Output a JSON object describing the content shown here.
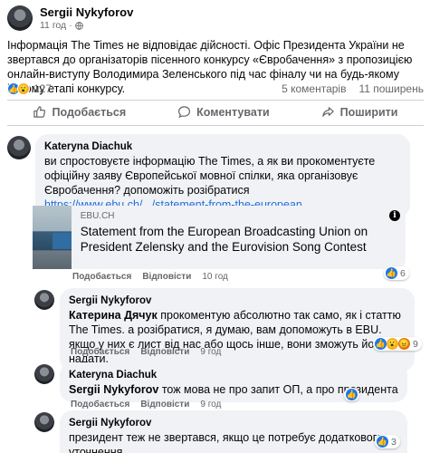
{
  "post": {
    "author": "Sergii Nykyforov",
    "time": "11 год",
    "text": "Інформація The Times не відповідає дійсності. Офіс Президента України не звертався до організаторів пісенного конкурсу «Євробачення» з пропозицією онлайн-виступу Володимира Зеленського під час фіналу чи на будь-якому іншому етапі конкурсу.",
    "reactions_count": "127",
    "comments_count": "5 коментарів",
    "shares_count": "11 поширень"
  },
  "actions": {
    "like": "Подобається",
    "comment": "Коментувати",
    "share": "Поширити"
  },
  "comments": [
    {
      "author": "Kateryna Diachuk",
      "text": "ви спростовуєте інформацію The Times, а як ви прокоментуєте офіційну заяву Європейської мовної спілки, яка організовує Євробачення? допоможіть розібратися",
      "link": "https://www.ebu.ch/.../statement-from-the-european...",
      "card_domain": "EBU.CH",
      "card_title": "Statement from the European Broadcasting Union on President Zelensky and the Eurovision Song Contest",
      "like": "Подобається",
      "reply": "Відповісти",
      "time": "10 год",
      "reactions": "6"
    },
    {
      "author": "Sergii Nykyforov",
      "tag": "Катерина Дячук",
      "text": " прокоментую абсолютно так само, як і статтю The Times. а розібратися, я думаю, вам допоможуть в EBU. якщо у них є лист від нас або щось інше, вони зможуть його надати.",
      "like": "Подобається",
      "reply": "Відповісти",
      "time": "9 год",
      "reactions": "9"
    },
    {
      "author": "Kateryna Diachuk",
      "tag": "Sergii Nykyforov",
      "text": " тож мова не про запит ОП, а про президента",
      "like": "Подобається",
      "reply": "Відповісти",
      "time": "9 год"
    },
    {
      "author": "Sergii Nykyforov",
      "text": "президент теж не звертався, якщо це потребує додаткового уточнення",
      "reactions": "3"
    }
  ]
}
